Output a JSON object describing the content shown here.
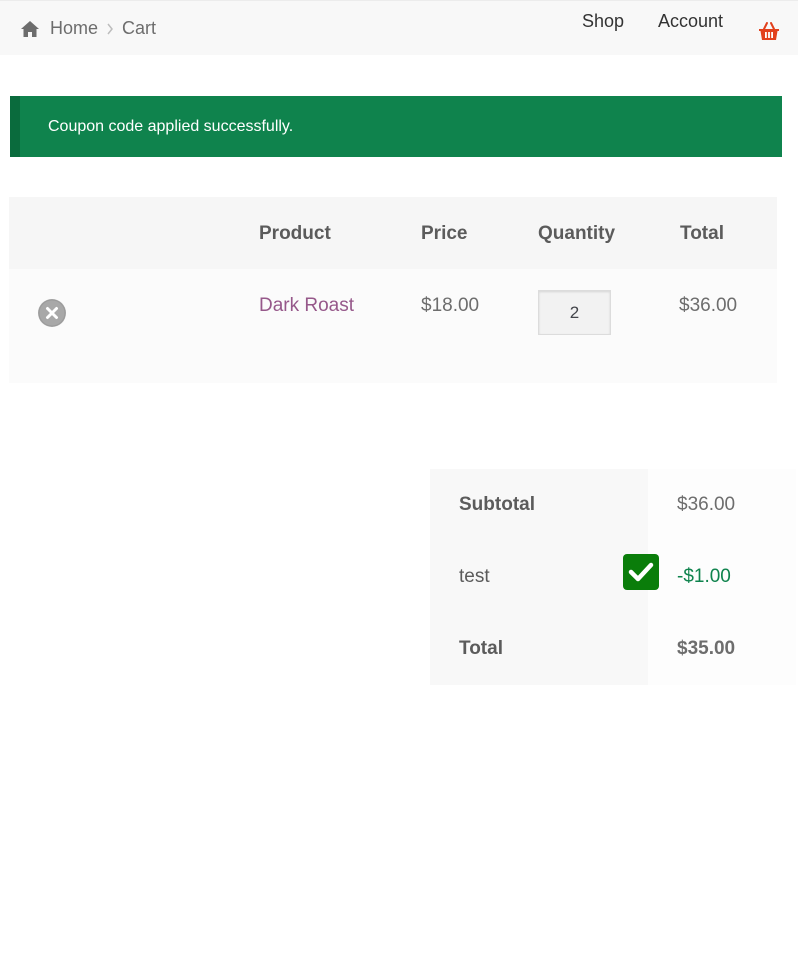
{
  "breadcrumb": {
    "home": "Home",
    "current": "Cart",
    "home_icon": "home-icon",
    "separator_icon": "chevron-right-icon"
  },
  "nav": {
    "shop": "Shop",
    "account": "Account",
    "cart_icon": "basket-icon",
    "cart_icon_color": "#e2401c"
  },
  "notice": {
    "message": "Coupon code applied successfully.",
    "color": "#0f834d"
  },
  "cart": {
    "columns": {
      "product": "Product",
      "price": "Price",
      "quantity": "Quantity",
      "total": "Total"
    },
    "items": [
      {
        "name": "Dark Roast",
        "price": "$18.00",
        "quantity": "2",
        "total": "$36.00",
        "remove_icon": "remove-circle-icon"
      }
    ]
  },
  "totals": {
    "subtotal_label": "Subtotal",
    "subtotal_value": "$36.00",
    "coupon_label": "test",
    "coupon_value": "-$1.00",
    "coupon_checkbox": "checked",
    "total_label": "Total",
    "total_value": "$35.00"
  },
  "colors": {
    "product_link": "#96588a",
    "discount": "#0f834d",
    "checkbox": "#0a7d0a"
  }
}
